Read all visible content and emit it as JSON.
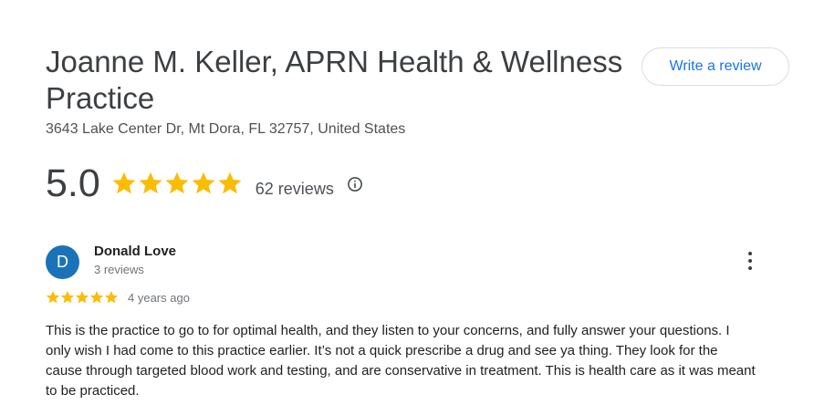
{
  "business": {
    "name": "Joanne M. Keller, APRN Health & Wellness Practice",
    "address": "3643 Lake Center Dr, Mt Dora, FL 32757, United States",
    "rating": "5.0",
    "rating_stars": 5,
    "review_count": "62 reviews"
  },
  "actions": {
    "write_review_label": "Write a review"
  },
  "review": {
    "avatar_letter": "D",
    "author": "Donald Love",
    "author_review_count": "3 reviews",
    "stars": 5,
    "date": "4 years ago",
    "text": "This is the practice to go to for optimal health, and they listen to your concerns, and fully answer your questions. I only wish I had come to this practice earlier. It’s not a quick prescribe a drug and see ya thing. They look for the cause through targeted blood work and testing, and are conservative in treatment. This is health care as it was meant to be practiced."
  },
  "icons": {
    "star": "star-icon",
    "info": "info-icon",
    "more": "more-vert-icon"
  },
  "colors": {
    "star": "#fbbc04",
    "link": "#1a73e8",
    "avatar": "#1a73b8"
  }
}
